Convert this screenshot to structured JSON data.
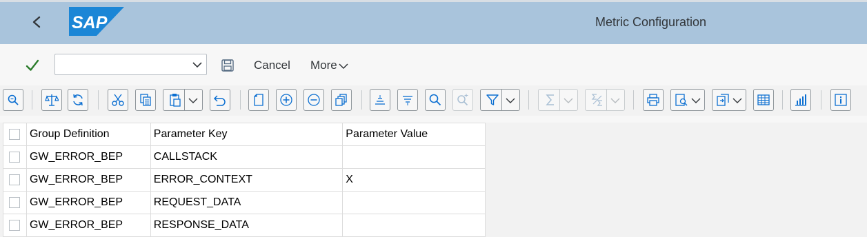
{
  "shell": {
    "logo_text": "SAP",
    "title": "Metric Configuration"
  },
  "actionbar": {
    "command_value": "",
    "cancel_label": "Cancel",
    "more_label": "More"
  },
  "toolbar_icons": [
    "zoom-icon",
    "compare-icon",
    "refresh-icon",
    "cut-icon",
    "copy-icon",
    "paste-icon",
    "undo-icon",
    "new-page-icon",
    "add-row-icon",
    "remove-row-icon",
    "duplicate-icon",
    "sort-ascending-icon",
    "sort-descending-icon",
    "find-icon",
    "find-next-icon",
    "filter-icon",
    "sum-icon",
    "subtotal-icon",
    "print-icon",
    "print-preview-icon",
    "export-icon",
    "layout-grid-icon",
    "chart-icon",
    "info-icon"
  ],
  "colors": {
    "shell_bg": "#a9c4dc",
    "accent_check": "#2b7c2b",
    "icon_color": "#0a6ed1"
  },
  "table": {
    "columns": [
      "Group Definition",
      "Parameter Key",
      "Parameter Value"
    ],
    "rows": [
      [
        "GW_ERROR_BEP",
        "CALLSTACK",
        ""
      ],
      [
        "GW_ERROR_BEP",
        "ERROR_CONTEXT",
        "X"
      ],
      [
        "GW_ERROR_BEP",
        "REQUEST_DATA",
        ""
      ],
      [
        "GW_ERROR_BEP",
        "RESPONSE_DATA",
        ""
      ]
    ]
  }
}
